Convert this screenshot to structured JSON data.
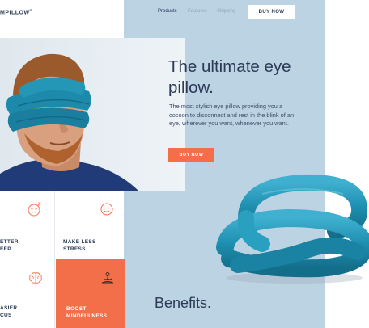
{
  "header": {
    "logo": "MPILLOW",
    "logo_mark": "®",
    "nav": [
      "Products",
      "Features",
      "Shipping"
    ],
    "buy_button": "BUY NOW"
  },
  "hero": {
    "title": "The ultimate eye pillow.",
    "description": "The most stylish eye pillow providing you a cocoon to disconnect and rest in the blink of an eye, wherever you want, whenever you want.",
    "cta": "BUY NOW"
  },
  "benefits": {
    "title": "Benefits.",
    "items": [
      {
        "label_line1": "ETTER",
        "label_line2": "EEP",
        "icon": "sleeping-face-icon"
      },
      {
        "label_line1": "MAKE LESS",
        "label_line2": "STRESS",
        "icon": "smiling-face-icon"
      },
      {
        "label_line1": "ASIER",
        "label_line2": "CUS",
        "icon": "brain-icon"
      },
      {
        "label_line1": "BOOST",
        "label_line2": "MINDFULNESS",
        "icon": "meditation-icon"
      }
    ]
  },
  "colors": {
    "accent": "#f26f49",
    "panel": "#bcd3e4",
    "text": "#2b3a55",
    "pillow": "#1e8fb0"
  }
}
